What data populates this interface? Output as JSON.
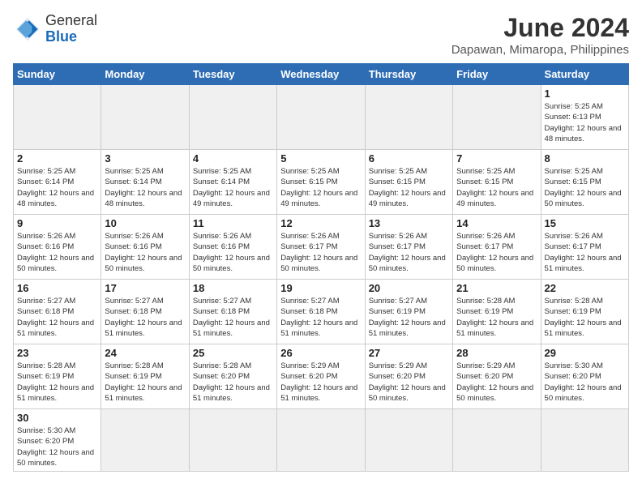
{
  "header": {
    "logo_line1": "General",
    "logo_line2": "Blue",
    "month": "June 2024",
    "location": "Dapawan, Mimaropa, Philippines"
  },
  "weekdays": [
    "Sunday",
    "Monday",
    "Tuesday",
    "Wednesday",
    "Thursday",
    "Friday",
    "Saturday"
  ],
  "days": [
    {
      "day": "",
      "info": "",
      "empty": true
    },
    {
      "day": "",
      "info": "",
      "empty": true
    },
    {
      "day": "",
      "info": "",
      "empty": true
    },
    {
      "day": "",
      "info": "",
      "empty": true
    },
    {
      "day": "",
      "info": "",
      "empty": true
    },
    {
      "day": "",
      "info": "",
      "empty": true
    },
    {
      "day": "1",
      "info": "Sunrise: 5:25 AM\nSunset: 6:13 PM\nDaylight: 12 hours\nand 48 minutes.",
      "empty": false
    },
    {
      "day": "2",
      "info": "Sunrise: 5:25 AM\nSunset: 6:14 PM\nDaylight: 12 hours\nand 48 minutes.",
      "empty": false
    },
    {
      "day": "3",
      "info": "Sunrise: 5:25 AM\nSunset: 6:14 PM\nDaylight: 12 hours\nand 48 minutes.",
      "empty": false
    },
    {
      "day": "4",
      "info": "Sunrise: 5:25 AM\nSunset: 6:14 PM\nDaylight: 12 hours\nand 49 minutes.",
      "empty": false
    },
    {
      "day": "5",
      "info": "Sunrise: 5:25 AM\nSunset: 6:15 PM\nDaylight: 12 hours\nand 49 minutes.",
      "empty": false
    },
    {
      "day": "6",
      "info": "Sunrise: 5:25 AM\nSunset: 6:15 PM\nDaylight: 12 hours\nand 49 minutes.",
      "empty": false
    },
    {
      "day": "7",
      "info": "Sunrise: 5:25 AM\nSunset: 6:15 PM\nDaylight: 12 hours\nand 49 minutes.",
      "empty": false
    },
    {
      "day": "8",
      "info": "Sunrise: 5:25 AM\nSunset: 6:15 PM\nDaylight: 12 hours\nand 50 minutes.",
      "empty": false
    },
    {
      "day": "9",
      "info": "Sunrise: 5:26 AM\nSunset: 6:16 PM\nDaylight: 12 hours\nand 50 minutes.",
      "empty": false
    },
    {
      "day": "10",
      "info": "Sunrise: 5:26 AM\nSunset: 6:16 PM\nDaylight: 12 hours\nand 50 minutes.",
      "empty": false
    },
    {
      "day": "11",
      "info": "Sunrise: 5:26 AM\nSunset: 6:16 PM\nDaylight: 12 hours\nand 50 minutes.",
      "empty": false
    },
    {
      "day": "12",
      "info": "Sunrise: 5:26 AM\nSunset: 6:17 PM\nDaylight: 12 hours\nand 50 minutes.",
      "empty": false
    },
    {
      "day": "13",
      "info": "Sunrise: 5:26 AM\nSunset: 6:17 PM\nDaylight: 12 hours\nand 50 minutes.",
      "empty": false
    },
    {
      "day": "14",
      "info": "Sunrise: 5:26 AM\nSunset: 6:17 PM\nDaylight: 12 hours\nand 50 minutes.",
      "empty": false
    },
    {
      "day": "15",
      "info": "Sunrise: 5:26 AM\nSunset: 6:17 PM\nDaylight: 12 hours\nand 51 minutes.",
      "empty": false
    },
    {
      "day": "16",
      "info": "Sunrise: 5:27 AM\nSunset: 6:18 PM\nDaylight: 12 hours\nand 51 minutes.",
      "empty": false
    },
    {
      "day": "17",
      "info": "Sunrise: 5:27 AM\nSunset: 6:18 PM\nDaylight: 12 hours\nand 51 minutes.",
      "empty": false
    },
    {
      "day": "18",
      "info": "Sunrise: 5:27 AM\nSunset: 6:18 PM\nDaylight: 12 hours\nand 51 minutes.",
      "empty": false
    },
    {
      "day": "19",
      "info": "Sunrise: 5:27 AM\nSunset: 6:18 PM\nDaylight: 12 hours\nand 51 minutes.",
      "empty": false
    },
    {
      "day": "20",
      "info": "Sunrise: 5:27 AM\nSunset: 6:19 PM\nDaylight: 12 hours\nand 51 minutes.",
      "empty": false
    },
    {
      "day": "21",
      "info": "Sunrise: 5:28 AM\nSunset: 6:19 PM\nDaylight: 12 hours\nand 51 minutes.",
      "empty": false
    },
    {
      "day": "22",
      "info": "Sunrise: 5:28 AM\nSunset: 6:19 PM\nDaylight: 12 hours\nand 51 minutes.",
      "empty": false
    },
    {
      "day": "23",
      "info": "Sunrise: 5:28 AM\nSunset: 6:19 PM\nDaylight: 12 hours\nand 51 minutes.",
      "empty": false
    },
    {
      "day": "24",
      "info": "Sunrise: 5:28 AM\nSunset: 6:19 PM\nDaylight: 12 hours\nand 51 minutes.",
      "empty": false
    },
    {
      "day": "25",
      "info": "Sunrise: 5:28 AM\nSunset: 6:20 PM\nDaylight: 12 hours\nand 51 minutes.",
      "empty": false
    },
    {
      "day": "26",
      "info": "Sunrise: 5:29 AM\nSunset: 6:20 PM\nDaylight: 12 hours\nand 51 minutes.",
      "empty": false
    },
    {
      "day": "27",
      "info": "Sunrise: 5:29 AM\nSunset: 6:20 PM\nDaylight: 12 hours\nand 50 minutes.",
      "empty": false
    },
    {
      "day": "28",
      "info": "Sunrise: 5:29 AM\nSunset: 6:20 PM\nDaylight: 12 hours\nand 50 minutes.",
      "empty": false
    },
    {
      "day": "29",
      "info": "Sunrise: 5:30 AM\nSunset: 6:20 PM\nDaylight: 12 hours\nand 50 minutes.",
      "empty": false
    },
    {
      "day": "30",
      "info": "Sunrise: 5:30 AM\nSunset: 6:20 PM\nDaylight: 12 hours\nand 50 minutes.",
      "empty": false
    },
    {
      "day": "",
      "info": "",
      "empty": true
    },
    {
      "day": "",
      "info": "",
      "empty": true
    },
    {
      "day": "",
      "info": "",
      "empty": true
    },
    {
      "day": "",
      "info": "",
      "empty": true
    },
    {
      "day": "",
      "info": "",
      "empty": true
    },
    {
      "day": "",
      "info": "",
      "empty": true
    }
  ]
}
